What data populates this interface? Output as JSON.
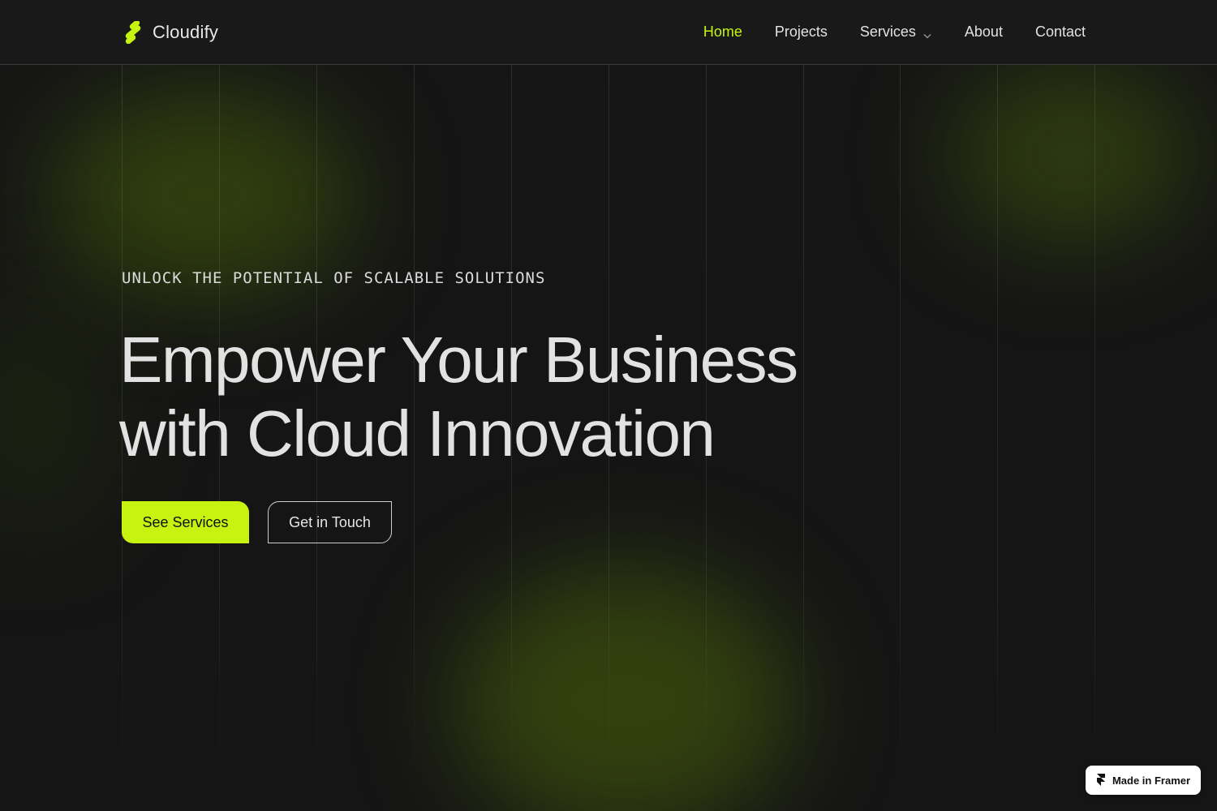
{
  "brand": {
    "name": "Cloudify",
    "accent": "#c6f30f",
    "logo_icon": "cloudify-logo-icon"
  },
  "nav": {
    "items": [
      {
        "label": "Home",
        "active": true
      },
      {
        "label": "Projects",
        "active": false
      },
      {
        "label": "Services",
        "active": false,
        "has_dropdown": true
      },
      {
        "label": "About",
        "active": false
      },
      {
        "label": "Contact",
        "active": false
      }
    ]
  },
  "hero": {
    "eyebrow": "UNLOCK THE POTENTIAL OF SCALABLE SOLUTIONS",
    "headline_line1": "Empower Your Business",
    "headline_line2": "with Cloud Innovation",
    "primary_button": "See Services",
    "secondary_button": "Get in Touch"
  },
  "badge": {
    "label": "Made in Framer",
    "icon": "framer-icon"
  }
}
